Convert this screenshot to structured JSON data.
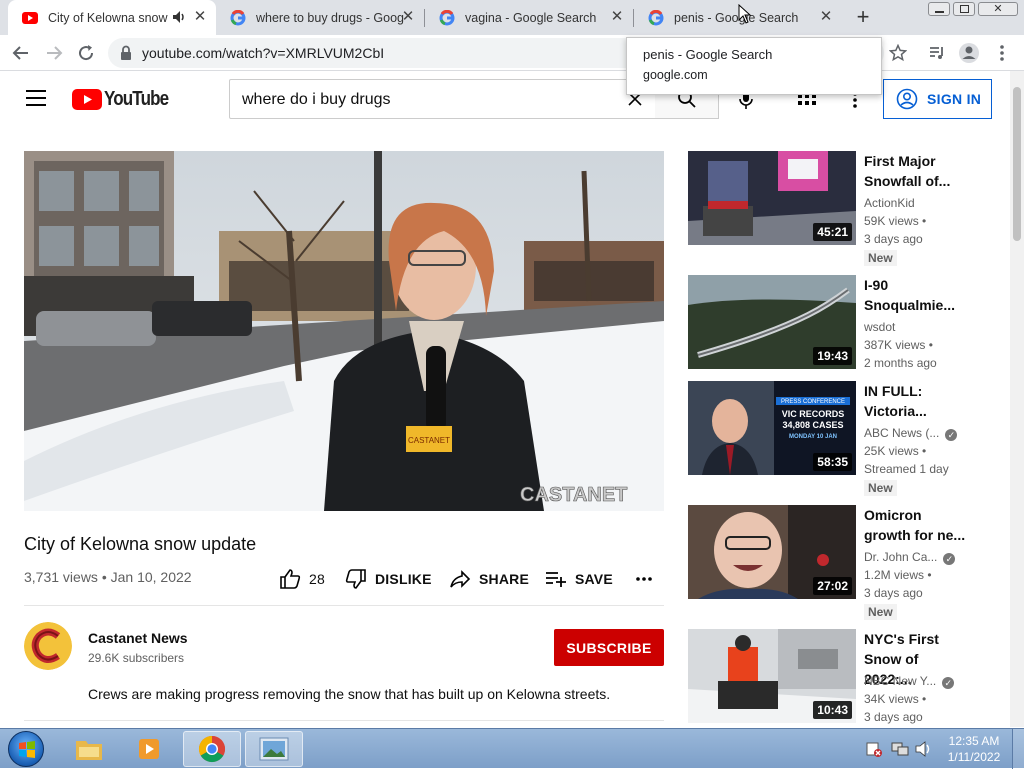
{
  "browser": {
    "tabs": [
      {
        "title": "City of Kelowna snow update - YouTube",
        "active": true
      },
      {
        "title": "where to buy drugs - Google Search",
        "active": false
      },
      {
        "title": "vagina - Google Search",
        "active": false
      },
      {
        "title": "penis - Google Search",
        "active": false
      }
    ],
    "url": "youtube.com/watch?v=XMRLVUM2CbI",
    "tooltip": {
      "title": "penis - Google Search",
      "domain": "google.com"
    }
  },
  "youtube": {
    "logo_text": "YouTube",
    "search_query": "where do i buy drugs",
    "sign_in_label": "SIGN IN",
    "brand_color": "#ff0000",
    "link_color": "#065fd4"
  },
  "video": {
    "title": "City of Kelowna snow update",
    "meta": "3,731 views • Jan 10, 2022",
    "like_count": "28",
    "dislike_label": "DISLIKE",
    "share_label": "SHARE",
    "save_label": "SAVE",
    "watermark": "CASTANET",
    "channel": {
      "name": "Castanet News",
      "subscribers": "29.6K subscribers"
    },
    "subscribe_label": "SUBSCRIBE",
    "description": "Crews are making progress removing the snow that has built up on Kelowna streets."
  },
  "recommendations": [
    {
      "title": "First Major Snowfall of...",
      "channel": "ActionKid",
      "verified": false,
      "views": "59K views",
      "age": "3 days ago",
      "badge": "New",
      "duration": "45:21"
    },
    {
      "title": "I-90 Snoqualmie...",
      "channel": "wsdot",
      "verified": false,
      "views": "387K views",
      "age": "2 months ago",
      "badge": "",
      "duration": "19:43"
    },
    {
      "title": "IN FULL: Victoria...",
      "channel": "ABC News (...",
      "verified": true,
      "views": "25K views",
      "age": "Streamed 1 day",
      "badge": "New",
      "duration": "58:35",
      "thumb_text": [
        "PRESS CONFERENCE",
        "VIC RECORDS",
        "34,808 CASES",
        "MONDAY 10 JAN"
      ]
    },
    {
      "title": "Omicron growth for ne...",
      "channel": "Dr. John Ca...",
      "verified": true,
      "views": "1.2M views",
      "age": "3 days ago",
      "badge": "New",
      "duration": "27:02"
    },
    {
      "title": "NYC's First Snow of 2022:...",
      "channel": "NBC New Y...",
      "verified": true,
      "views": "34K views",
      "age": "3 days ago",
      "badge": "",
      "duration": "10:43"
    }
  ],
  "taskbar": {
    "time": "12:35 AM",
    "date": "1/11/2022"
  }
}
